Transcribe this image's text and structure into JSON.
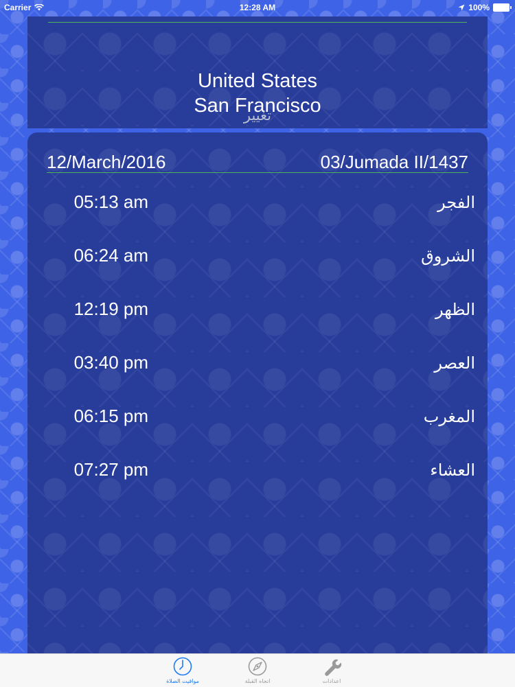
{
  "status": {
    "carrier": "Carrier",
    "time": "12:28 AM",
    "battery": "100%"
  },
  "location": {
    "country": "United States",
    "city": "San Francisco",
    "change_label": "تغيير"
  },
  "dates": {
    "gregorian": "12/March/2016",
    "hijri": "03/Jumada II/1437"
  },
  "prayers": [
    {
      "name": "الفجر",
      "time": "05:13 am"
    },
    {
      "name": "الشروق",
      "time": "06:24 am"
    },
    {
      "name": "الظهر",
      "time": "12:19 pm"
    },
    {
      "name": "العصر",
      "time": "03:40 pm"
    },
    {
      "name": "المغرب",
      "time": "06:15 pm"
    },
    {
      "name": "العشاء",
      "time": "07:27 pm"
    }
  ],
  "tabs": [
    {
      "label": "مواقيت الصلاة",
      "icon": "clock-icon",
      "active": true
    },
    {
      "label": "اتجاه القبلة",
      "icon": "compass-icon",
      "active": false
    },
    {
      "label": "اعدادات",
      "icon": "wrench-icon",
      "active": false
    }
  ],
  "colors": {
    "accent": "#1c7cf4",
    "panel": "#283c9a",
    "background": "#3f63e6",
    "divider": "#4fb35a"
  }
}
